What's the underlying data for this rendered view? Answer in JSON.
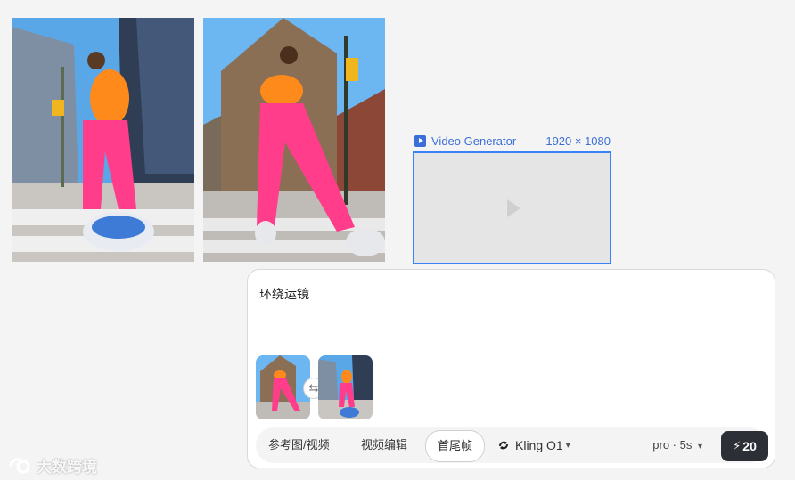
{
  "generator": {
    "title": "Video Generator",
    "resolution": "1920 × 1080",
    "accent": "#3b82f6"
  },
  "panel": {
    "prompt": "环绕运镜",
    "modes": [
      "参考图/视频",
      "视频编辑",
      "首尾帧"
    ],
    "active_mode": "首尾帧",
    "model": "Kling O1",
    "settings": "pro · 5s",
    "credits": "20"
  },
  "icons": [
    "play-icon",
    "swap-icon",
    "kling-logo-icon",
    "chevron-down-icon",
    "bolt-icon"
  ],
  "watermark": "大数跨境"
}
